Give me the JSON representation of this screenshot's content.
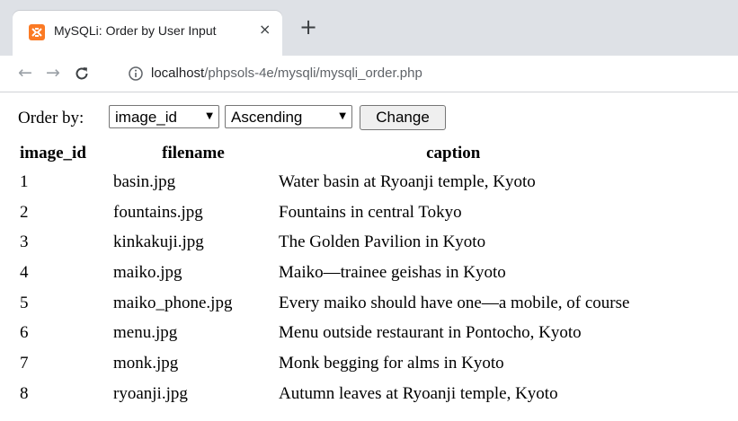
{
  "browser": {
    "tab_title": "MySQLi: Order by User Input",
    "close_glyph": "×",
    "new_tab_glyph": "+",
    "url_host": "localhost",
    "url_path": "/phpsols-4e/mysqli/mysqli_order.php",
    "icons": [
      "xampp-favicon-icon",
      "back-arrow-icon",
      "forward-arrow-icon",
      "reload-icon",
      "info-icon"
    ],
    "accent_color": "#fb7a24"
  },
  "form": {
    "label": "Order by:",
    "order_field": {
      "selected": "image_id"
    },
    "direction": {
      "selected": "Ascending"
    },
    "submit_label": "Change"
  },
  "table": {
    "columns": [
      "image_id",
      "filename",
      "caption"
    ],
    "rows": [
      [
        "1",
        "basin.jpg",
        "Water basin at Ryoanji temple, Kyoto"
      ],
      [
        "2",
        "fountains.jpg",
        "Fountains in central Tokyo"
      ],
      [
        "3",
        "kinkakuji.jpg",
        "The Golden Pavilion in Kyoto"
      ],
      [
        "4",
        "maiko.jpg",
        "Maiko—trainee geishas in Kyoto"
      ],
      [
        "5",
        "maiko_phone.jpg",
        "Every maiko should have one—a mobile, of course"
      ],
      [
        "6",
        "menu.jpg",
        "Menu outside restaurant in Pontocho, Kyoto"
      ],
      [
        "7",
        "monk.jpg",
        "Monk begging for alms in Kyoto"
      ],
      [
        "8",
        "ryoanji.jpg",
        "Autumn leaves at Ryoanji temple, Kyoto"
      ]
    ]
  }
}
